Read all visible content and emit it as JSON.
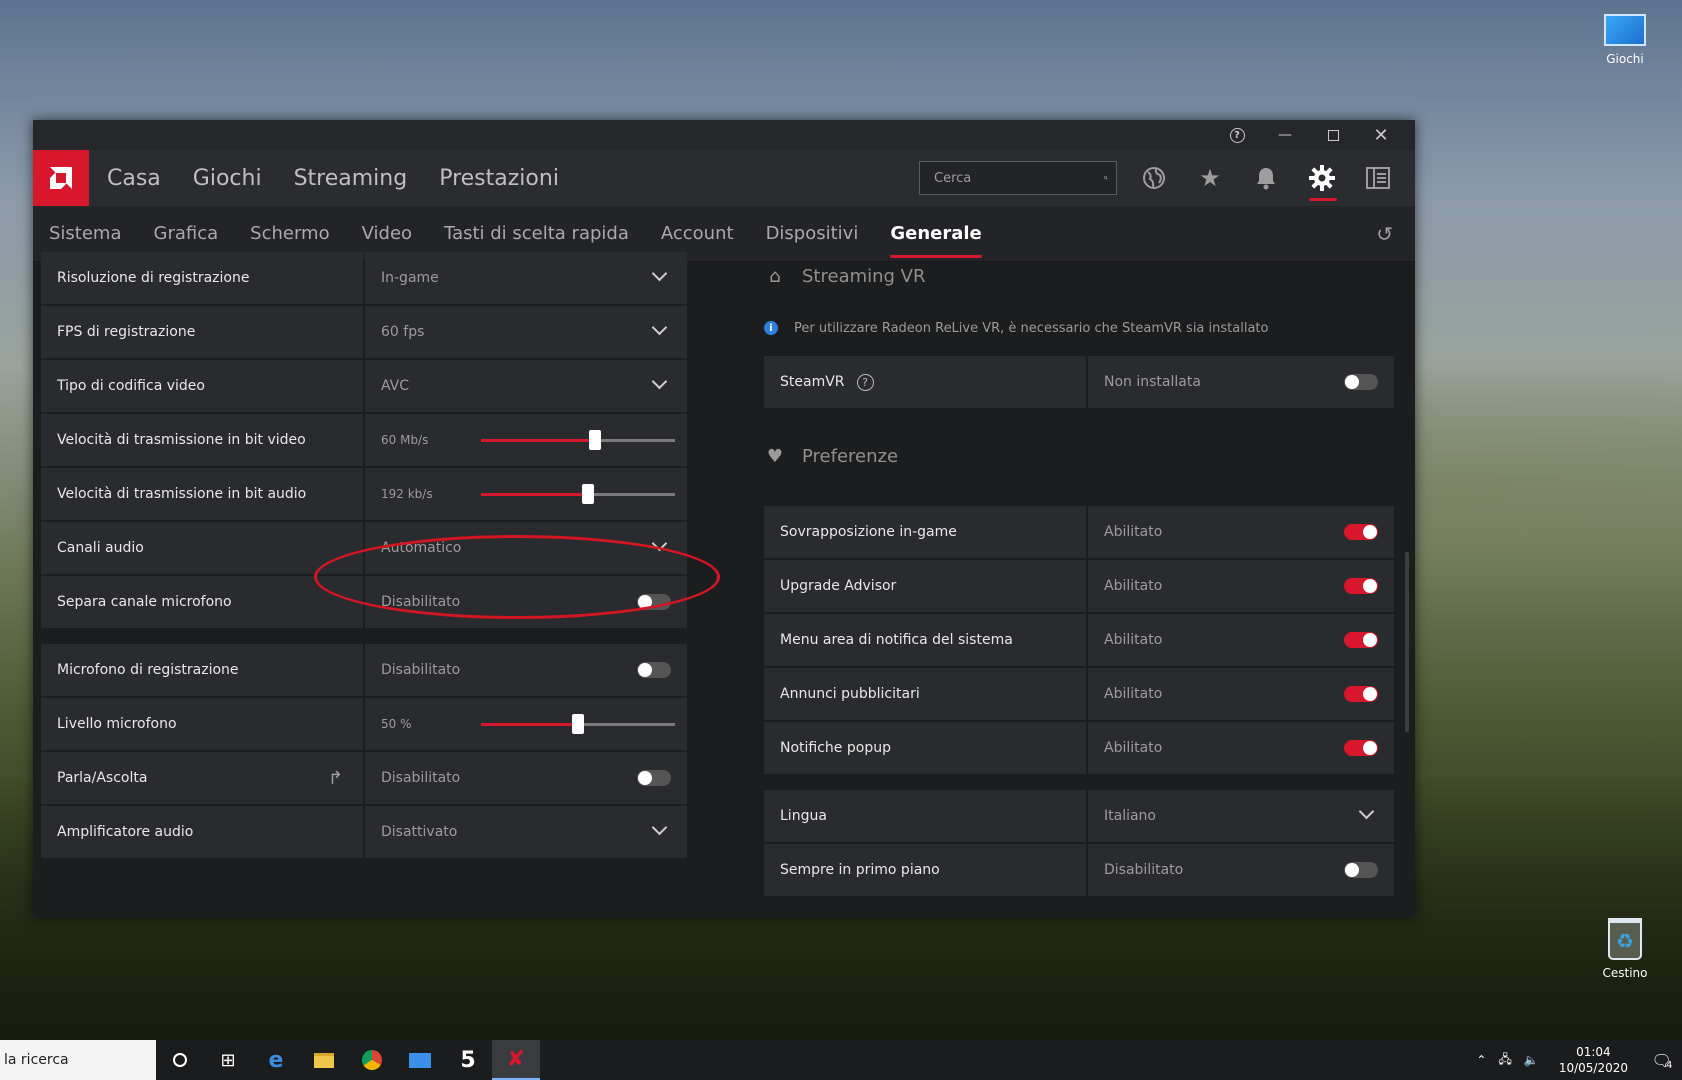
{
  "desktop": {
    "icons": [
      {
        "label": "Giochi",
        "icon": "monitor-icon"
      },
      {
        "label": "Cestino",
        "icon": "recycle-bin-icon"
      }
    ]
  },
  "titlebar": {
    "buttons": [
      "help-icon",
      "minimize-icon",
      "maximize-icon",
      "close-icon"
    ]
  },
  "topnav": {
    "tabs": [
      "Casa",
      "Giochi",
      "Streaming",
      "Prestazioni"
    ],
    "search_placeholder": "Cerca",
    "icons": [
      "globe-icon",
      "star-icon",
      "bell-icon",
      "gear-icon",
      "panel-icon"
    ],
    "active_icon": "gear-icon"
  },
  "subnav": {
    "tabs": [
      "Sistema",
      "Grafica",
      "Schermo",
      "Video",
      "Tasti di scelta rapida",
      "Account",
      "Dispositivi",
      "Generale"
    ],
    "active": "Generale"
  },
  "left": {
    "group1": [
      {
        "label": "Risoluzione di registrazione",
        "value": "In-game",
        "control": "dropdown"
      },
      {
        "label": "FPS di registrazione",
        "value": "60 fps",
        "control": "dropdown"
      },
      {
        "label": "Tipo di codifica video",
        "value": "AVC",
        "control": "dropdown"
      },
      {
        "label": "Velocità di trasmissione in bit video",
        "value": "60 Mb/s",
        "control": "slider",
        "fraction": 0.59
      },
      {
        "label": "Velocità di trasmissione in bit audio",
        "value": "192 kb/s",
        "control": "slider",
        "fraction": 0.55
      },
      {
        "label": "Canali audio",
        "value": "Automatico",
        "control": "dropdown"
      },
      {
        "label": "Separa canale microfono",
        "value": "Disabilitato",
        "control": "toggle",
        "on": false
      }
    ],
    "group2": [
      {
        "label": "Microfono di registrazione",
        "value": "Disabilitato",
        "control": "toggle",
        "on": false
      },
      {
        "label": "Livello microfono",
        "value": "50 %",
        "control": "slider",
        "fraction": 0.5
      },
      {
        "label": "Parla/Ascolta",
        "value": "Disabilitato",
        "control": "toggle",
        "on": false
      },
      {
        "label": "Amplificatore audio",
        "value": "Disattivato",
        "control": "dropdown"
      }
    ]
  },
  "right": {
    "streaming_vr": {
      "title": "Streaming VR",
      "info": "Per utilizzare Radeon ReLive VR, è necessario che SteamVR sia installato",
      "steamvr_label": "SteamVR",
      "steamvr_value": "Non installata",
      "steamvr_on": false
    },
    "preferences": {
      "title": "Preferenze",
      "rows": [
        {
          "label": "Sovrapposizione in-game",
          "value": "Abilitato",
          "on": true
        },
        {
          "label": "Upgrade Advisor",
          "value": "Abilitato",
          "on": true
        },
        {
          "label": "Menu area di notifica del sistema",
          "value": "Abilitato",
          "on": true
        },
        {
          "label": "Annunci pubblicitari",
          "value": "Abilitato",
          "on": true
        },
        {
          "label": "Notifiche popup",
          "value": "Abilitato",
          "on": true
        }
      ]
    },
    "other": [
      {
        "label": "Lingua",
        "value": "Italiano",
        "control": "dropdown"
      },
      {
        "label": "Sempre in primo piano",
        "value": "Disabilitato",
        "control": "toggle",
        "on": false
      }
    ]
  },
  "taskbar": {
    "search_text": "la ricerca",
    "time": "01:04",
    "date": "10/05/2020",
    "notification_count": "4"
  },
  "colors": {
    "accent": "#d9172c",
    "annotation": "#d31622"
  }
}
